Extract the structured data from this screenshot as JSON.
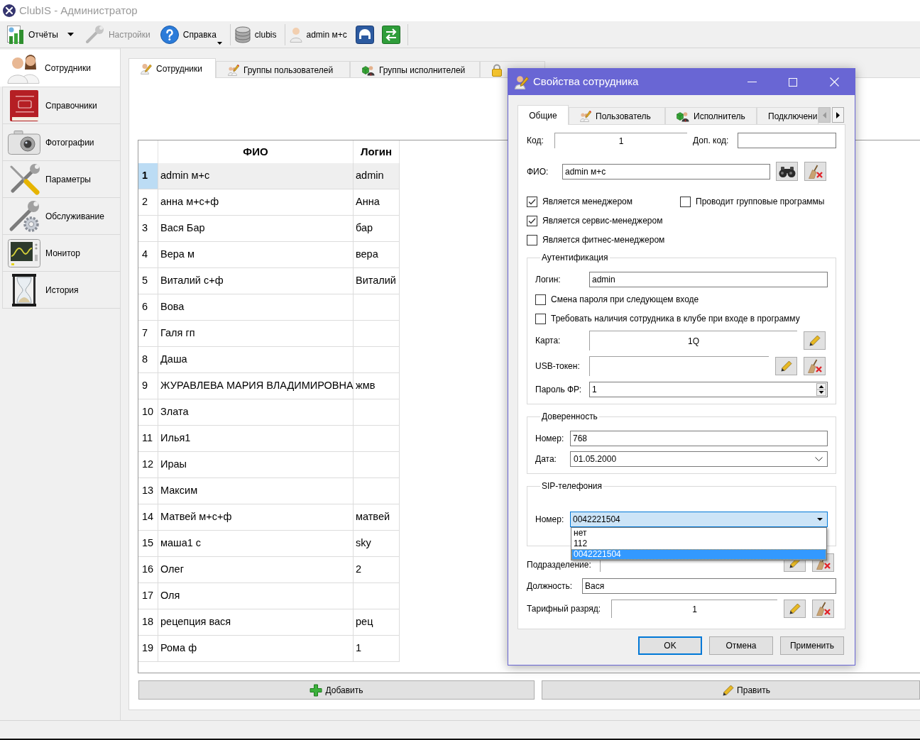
{
  "window": {
    "title": "ClubIS - Администратор"
  },
  "toolbar": [
    {
      "items": [
        {
          "kind": "split",
          "label": "Отчёты",
          "disabled": false
        },
        {
          "kind": "button",
          "label": "Настройки",
          "disabled": true
        },
        {
          "kind": "menu",
          "label": "Справка",
          "disabled": false
        }
      ]
    },
    {
      "items": [
        {
          "kind": "button",
          "label": "clubis",
          "disabled": false
        }
      ]
    },
    {
      "items": [
        {
          "kind": "button",
          "label": "admin м+с",
          "disabled": false
        },
        {
          "kind": "icon",
          "disabled": false
        },
        {
          "kind": "icon",
          "disabled": false
        }
      ]
    }
  ],
  "sidebar": {
    "items": [
      {
        "label": "Сотрудники",
        "selected": true
      },
      {
        "label": "Справочники",
        "selected": false
      },
      {
        "label": "Фотографии",
        "selected": false
      },
      {
        "label": "Параметры",
        "selected": false
      },
      {
        "label": "Обслуживание",
        "selected": false
      },
      {
        "label": "Монитор",
        "selected": false
      },
      {
        "label": "История",
        "selected": false
      }
    ]
  },
  "tabs": [
    {
      "label": "Сотрудники",
      "selected": true
    },
    {
      "label": "Группы пользователей",
      "selected": false
    },
    {
      "label": "Группы исполнителей",
      "selected": false
    },
    {
      "selected": false
    }
  ],
  "table": {
    "columns": [
      "ФИО",
      "Логин"
    ],
    "rows": [
      {
        "number": "1",
        "name": "admin м+с",
        "login": "admin",
        "selected": true
      },
      {
        "number": "2",
        "name": "анна м+с+ф",
        "login": "Анна",
        "selected": false
      },
      {
        "number": "3",
        "name": "Вася Бар",
        "login": "бар",
        "selected": false
      },
      {
        "number": "4",
        "name": "Вера м",
        "login": "вера",
        "selected": false
      },
      {
        "number": "5",
        "name": "Виталий с+ф",
        "login": "Виталий",
        "selected": false
      },
      {
        "number": "6",
        "name": "Вова",
        "selected": false
      },
      {
        "number": "7",
        "name": "Галя гп",
        "selected": false
      },
      {
        "number": "8",
        "name": "Даша",
        "selected": false
      },
      {
        "number": "9",
        "name": "ЖУРАВЛЕВА МАРИЯ ВЛАДИМИРОВНА",
        "login": "жмв",
        "selected": false
      },
      {
        "number": "10",
        "name": "Злата",
        "selected": false
      },
      {
        "number": "11",
        "name": "Илья1",
        "selected": false
      },
      {
        "number": "12",
        "name": "Ираы",
        "selected": false
      },
      {
        "number": "13",
        "name": "Максим",
        "selected": false
      },
      {
        "number": "14",
        "name": "Матвей м+с+ф",
        "login": "матвей",
        "selected": false
      },
      {
        "number": "15",
        "name": "маша1 с",
        "login": "sky",
        "selected": false
      },
      {
        "number": "16",
        "name": "Олег",
        "login": "2",
        "selected": false
      },
      {
        "number": "17",
        "name": "Оля",
        "selected": false
      },
      {
        "number": "18",
        "name": "рецепция вася",
        "login": "рец",
        "selected": false
      },
      {
        "number": "19",
        "name": "Рома ф",
        "login": "1",
        "selected": false
      }
    ]
  },
  "actions": [
    {
      "label": "Добавить"
    },
    {
      "label": "Править"
    }
  ],
  "dialog": {
    "title": "Свойства сотрудника",
    "tabs": [
      {
        "label": "Общие",
        "selected": true
      },
      {
        "label": "Пользователь",
        "selected": false
      },
      {
        "label": "Исполнитель",
        "selected": false
      },
      {
        "label": "Подключени",
        "selected": false
      }
    ],
    "tab_scroll": [
      {
        "kind": "back",
        "disabled": true
      },
      {
        "kind": "forward",
        "disabled": false
      }
    ],
    "code": {
      "label": "Код:",
      "value": "1"
    },
    "extra_code": {
      "label": "Доп. код:"
    },
    "full_name": {
      "label": "ФИО:",
      "value": "admin м+с"
    },
    "flags": [
      {
        "label": "Является менеджером",
        "checked": true
      },
      {
        "label": "Проводит групповые программы",
        "checked": false
      },
      {
        "label": "Является сервис-менеджером",
        "checked": true
      },
      {
        "label": "Является фитнес-менеджером",
        "checked": false
      }
    ],
    "authentication": {
      "title": "Аутентификация",
      "login": {
        "label": "Логин:",
        "value": "admin"
      },
      "options": [
        {
          "label": "Смена пароля при следующем входе",
          "checked": false
        },
        {
          "label": "Требовать наличия сотрудника в клубе при входе в программу",
          "checked": false
        }
      ],
      "card": {
        "label": "Карта:",
        "value": "1Q"
      },
      "usb_token": {
        "label": "USB-токен:"
      },
      "fr_password": {
        "label": "Пароль ФР:",
        "value": "1"
      }
    },
    "power_of_attorney": {
      "title": "Доверенность",
      "number": {
        "label": "Номер:",
        "value": "768"
      },
      "date": {
        "label": "Дата:",
        "value": "01.05.2000"
      }
    },
    "sip": {
      "title": "SIP-телефония",
      "number": {
        "label": "Номер:",
        "value": "0042221504",
        "expanded": true,
        "options": [
          {
            "label": "нет",
            "selected": false
          },
          {
            "label": "112",
            "selected": false
          },
          {
            "label": "0042221504",
            "selected": true
          }
        ]
      }
    },
    "department": {
      "label": "Подразделение:"
    },
    "position": {
      "label": "Должность:",
      "value": "Вася"
    },
    "tariff_grade": {
      "label": "Тарифный разряд:",
      "value": "1"
    },
    "buttons": [
      {
        "label": "OK",
        "default": true
      },
      {
        "label": "Отмена",
        "default": false
      },
      {
        "label": "Применить",
        "default": false
      }
    ]
  }
}
